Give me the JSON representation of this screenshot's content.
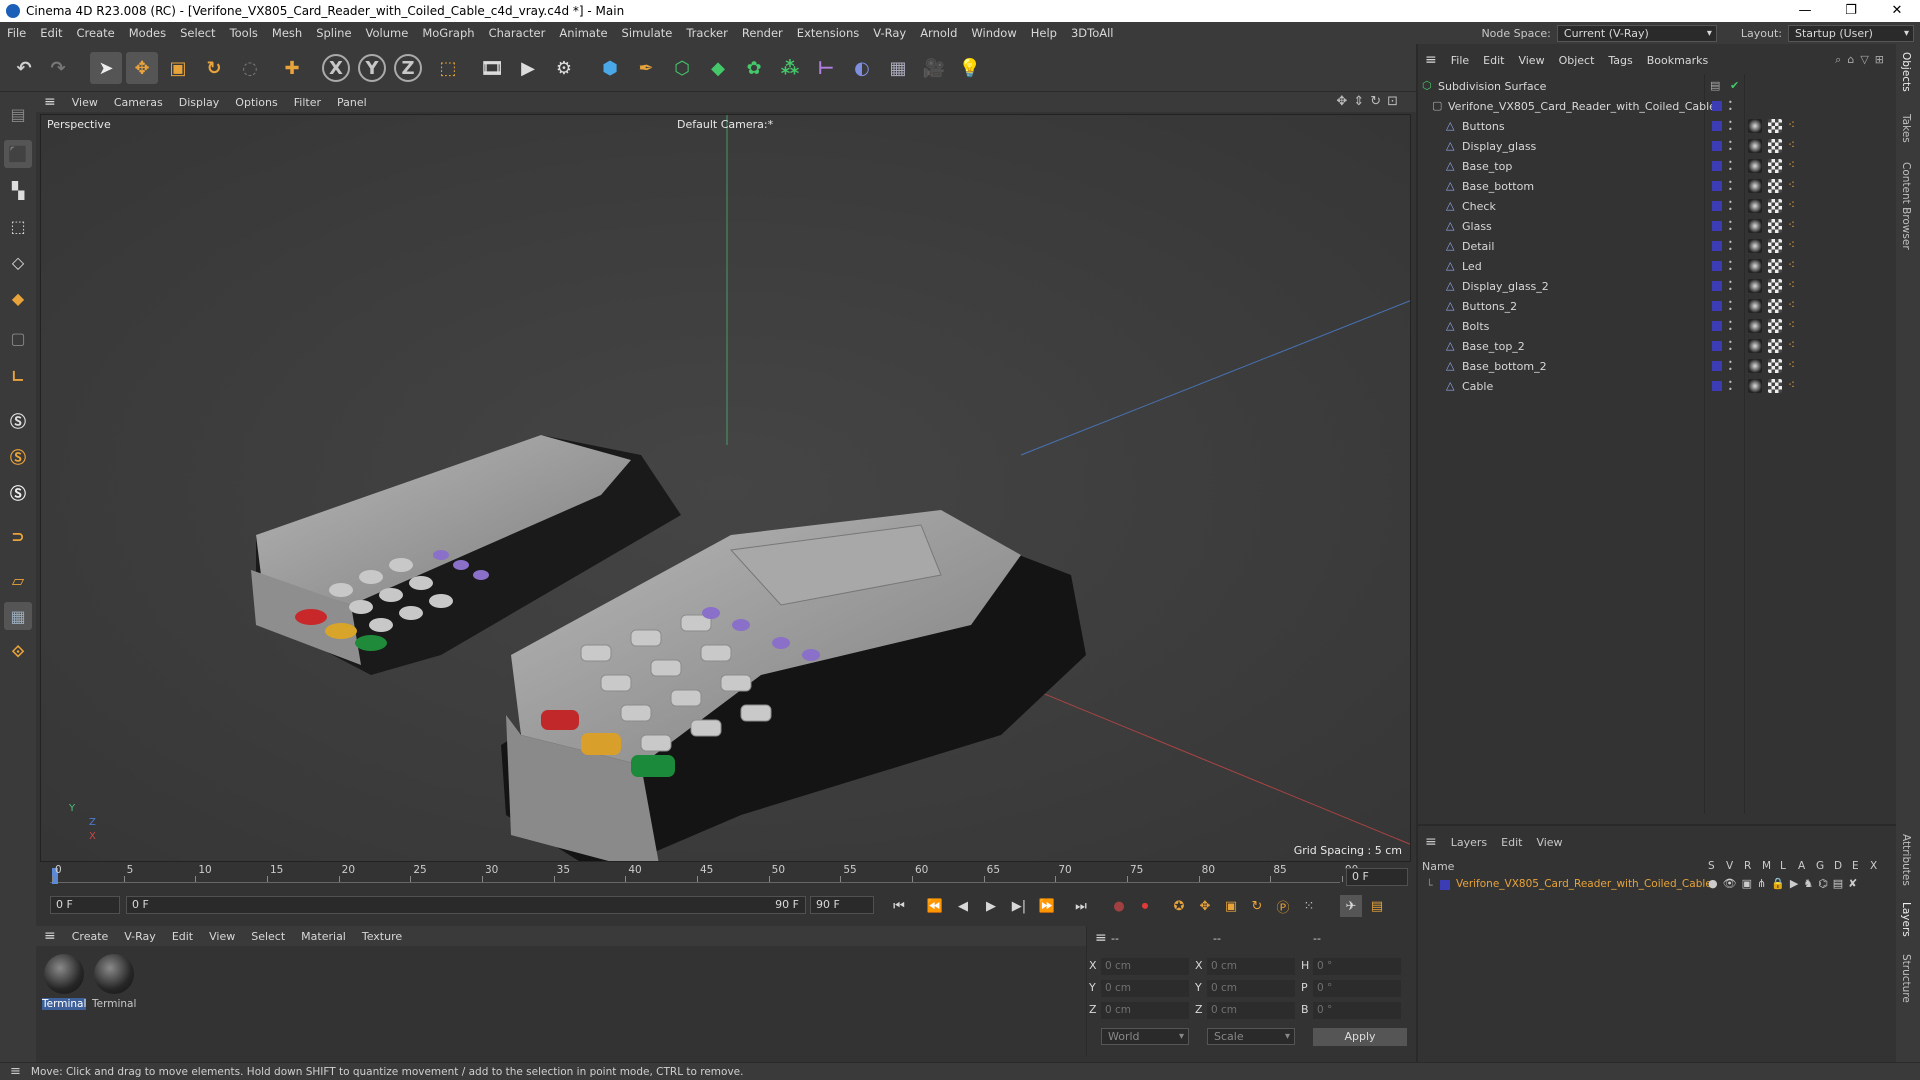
{
  "window": {
    "title": "Cinema 4D R23.008 (RC) - [Verifone_VX805_Card_Reader_with_Coiled_Cable_c4d_vray.c4d *] - Main",
    "controls": [
      "—",
      "❐",
      "✕"
    ]
  },
  "menubar": {
    "items": [
      "File",
      "Edit",
      "Create",
      "Modes",
      "Select",
      "Tools",
      "Mesh",
      "Spline",
      "Volume",
      "MoGraph",
      "Character",
      "Animate",
      "Simulate",
      "Tracker",
      "Render",
      "Extensions",
      "V-Ray",
      "Arnold",
      "Window",
      "Help",
      "3DToAll"
    ],
    "node_space_label": "Node Space:",
    "node_space_value": "Current (V-Ray)",
    "layout_label": "Layout:",
    "layout_value": "Startup (User)"
  },
  "toolbar": {
    "icons": [
      "undo-icon",
      "redo-icon",
      "select-arrow-icon",
      "move-icon",
      "scale-icon",
      "rotate-icon",
      "live-select-icon",
      "add-icon",
      "x-axis-icon",
      "y-axis-icon",
      "z-axis-icon",
      "coordinate-system-icon",
      "render-region-icon",
      "render-view-icon",
      "render-settings-icon",
      "cube-icon",
      "pen-icon",
      "subdivision-icon",
      "extrude-icon",
      "cloner-icon",
      "deformer-icon",
      "spline-icon",
      "floor-icon",
      "camera-icon",
      "light-icon"
    ],
    "axis_labels": [
      "X",
      "Y",
      "Z"
    ]
  },
  "viewport": {
    "menu": [
      "View",
      "Cameras",
      "Display",
      "Options",
      "Filter",
      "Panel"
    ],
    "mode_label": "Perspective",
    "camera_label": "Default Camera",
    "camera_suffix": ":*",
    "grid_spacing": "Grid Spacing : 5 cm",
    "axis_labels": [
      "Y",
      "Z",
      "X"
    ]
  },
  "timeline": {
    "ticks": [
      "0",
      "5",
      "10",
      "15",
      "20",
      "25",
      "30",
      "35",
      "40",
      "45",
      "50",
      "55",
      "60",
      "65",
      "70",
      "75",
      "80",
      "85",
      "90"
    ],
    "current_frame_right": "0 F",
    "start_field": "0 F",
    "range_start": "0 F",
    "range_end": "90 F",
    "end_field": "90 F"
  },
  "materials": {
    "menu": [
      "Create",
      "V-Ray",
      "Edit",
      "View",
      "Select",
      "Material",
      "Texture"
    ],
    "items": [
      {
        "label": "Terminal"
      },
      {
        "label": "Terminal"
      }
    ]
  },
  "coords": {
    "headers": [
      "--",
      "--",
      "--"
    ],
    "rows": [
      {
        "a": "X",
        "av": "0 cm",
        "b": "X",
        "bv": "0 cm",
        "c": "H",
        "cv": "0 °"
      },
      {
        "a": "Y",
        "av": "0 cm",
        "b": "Y",
        "bv": "0 cm",
        "c": "P",
        "cv": "0 °"
      },
      {
        "a": "Z",
        "av": "0 cm",
        "b": "Z",
        "bv": "0 cm",
        "c": "B",
        "cv": "0 °"
      }
    ],
    "mode1": "World",
    "mode2": "Scale",
    "apply": "Apply"
  },
  "status": {
    "text": "Move: Click and drag to move elements. Hold down SHIFT to quantize movement / add to the selection in point mode, CTRL to remove."
  },
  "objects": {
    "menu": [
      "File",
      "Edit",
      "View",
      "Object",
      "Tags",
      "Bookmarks"
    ],
    "root": "Subdivision Surface",
    "group": "Verifone_VX805_Card_Reader_with_Coiled_Cable",
    "children": [
      "Buttons",
      "Display_glass",
      "Base_top",
      "Base_bottom",
      "Check",
      "Glass",
      "Detail",
      "Led",
      "Display_glass_2",
      "Buttons_2",
      "Bolts",
      "Base_top_2",
      "Base_bottom_2",
      "Cable"
    ]
  },
  "layers": {
    "menu": [
      "Layers",
      "Edit",
      "View"
    ],
    "name_header": "Name",
    "columns": [
      "S",
      "V",
      "R",
      "M",
      "L",
      "A",
      "G",
      "D",
      "E",
      "X"
    ],
    "layer_name": "Verifone_VX805_Card_Reader_with_Coiled_Cable",
    "layer_color": "#3c3cb4"
  },
  "right_tabs": [
    "Objects",
    "Takes",
    "Content Browser",
    "Attributes",
    "Layers",
    "Structure"
  ],
  "colors": {
    "accent_orange": "#e8a33a",
    "accent_blue": "#3c3cb4",
    "axis_green": "#4fc07a",
    "axis_red": "#c84646",
    "axis_blue": "#4a7fd0"
  }
}
